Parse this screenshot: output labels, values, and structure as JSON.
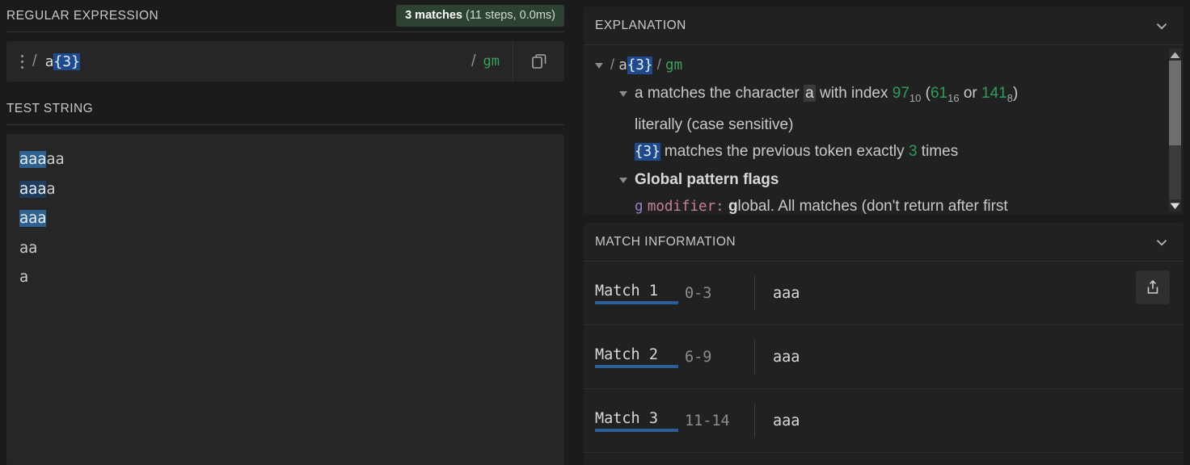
{
  "left": {
    "regex_section_label": "REGULAR EXPRESSION",
    "badge": {
      "matches_label": "3 matches",
      "stats_label": "(11 steps, 0.0ms)"
    },
    "regex_input": {
      "open_delimiter": "/",
      "pattern_plain": "a",
      "pattern_selected": "{3}",
      "close_delimiter": "/",
      "flags": "gm"
    },
    "test_section_label": "TEST STRING",
    "test_lines": [
      {
        "match": "aaa",
        "rest": "aa",
        "style": "hl-a"
      },
      {
        "match": "aaa",
        "rest": "a",
        "style": "hl-b"
      },
      {
        "match": "aaa",
        "rest": "",
        "style": "hl-a"
      },
      {
        "match": "",
        "rest": "aa",
        "style": ""
      },
      {
        "match": "",
        "rest": "a",
        "style": ""
      }
    ]
  },
  "explanation": {
    "title": "EXPLANATION",
    "header_row": {
      "slash1": "/",
      "token_plain": "a",
      "token_sel": "{3}",
      "slash2": "/",
      "flags": "gm"
    },
    "line_a_1": "a matches the character",
    "line_a_chip": "a",
    "line_a_2": "with index",
    "index_dec": "97",
    "index_dec_sub": "10",
    "paren_open": "(",
    "index_hex": "61",
    "index_hex_sub": "16",
    "or_word": "or",
    "index_oct": "141",
    "index_oct_sub": "8",
    "paren_close": ")",
    "line_literally": "literally (case sensitive)",
    "quant_token": "{3}",
    "quant_text_1": "matches the previous token exactly",
    "quant_count": "3",
    "quant_text_2": "times",
    "global_flags_title": "Global pattern flags",
    "g_flag": "g",
    "g_modifier": "modifier:",
    "g_bold": "g",
    "g_desc": "lobal. All matches (don't return after first"
  },
  "match_info": {
    "title": "MATCH INFORMATION",
    "rows": [
      {
        "label": "Match 1",
        "range": "0-3",
        "value": "aaa"
      },
      {
        "label": "Match 2",
        "range": "6-9",
        "value": "aaa"
      },
      {
        "label": "Match 3",
        "range": "11-14",
        "value": "aaa"
      }
    ]
  },
  "colors": {
    "background": "#1b1b1b",
    "panel": "#212121",
    "input": "#262626",
    "badge_green": "#2d4230",
    "selection_blue": "#1e4b8f",
    "highlight_light": "#2f6190",
    "highlight_dark": "#1e3c5c",
    "accent_underline": "#2a6099",
    "flag_green": "#3aa05a"
  }
}
